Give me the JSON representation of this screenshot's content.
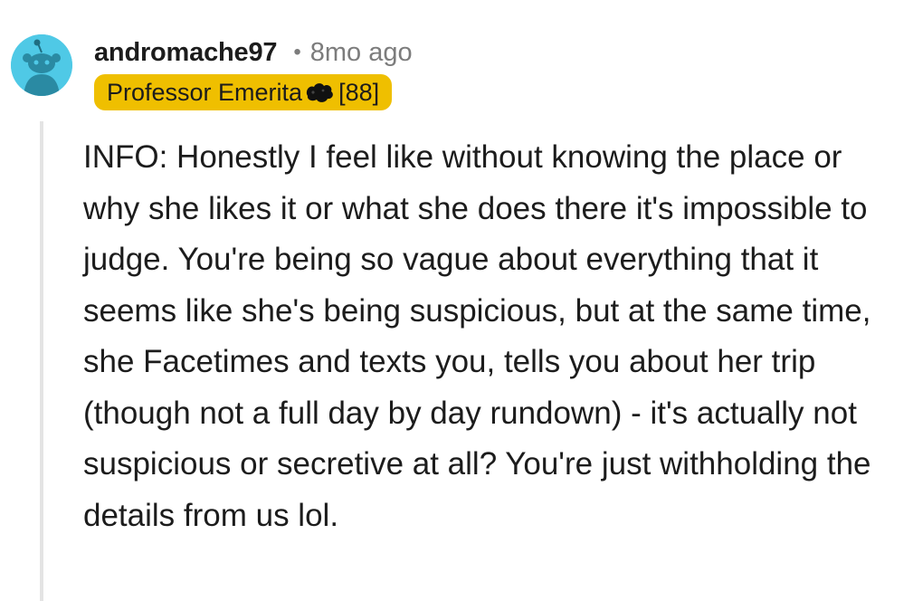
{
  "comment": {
    "username": "andromache97",
    "separator": "•",
    "age": "8mo ago",
    "flair": {
      "text_before": "Professor Emerita",
      "emoji_icon": "dark-blob-icon",
      "text_after": "[88]",
      "background_color": "#efbf00"
    },
    "avatar": {
      "icon": "reddit-snoo-avatar-icon",
      "background_color": "#4fc9e6"
    },
    "body": "INFO: Honestly I feel like without knowing the place or why she likes it or what she does there it's impossible to judge. You're being so vague about everything that it seems like she's being suspicious, but at the same time, she Facetimes and texts you, tells you about her trip (though not a full day by day rundown) - it's actually not suspicious or secretive at all? You're just withholding the details from us lol."
  }
}
